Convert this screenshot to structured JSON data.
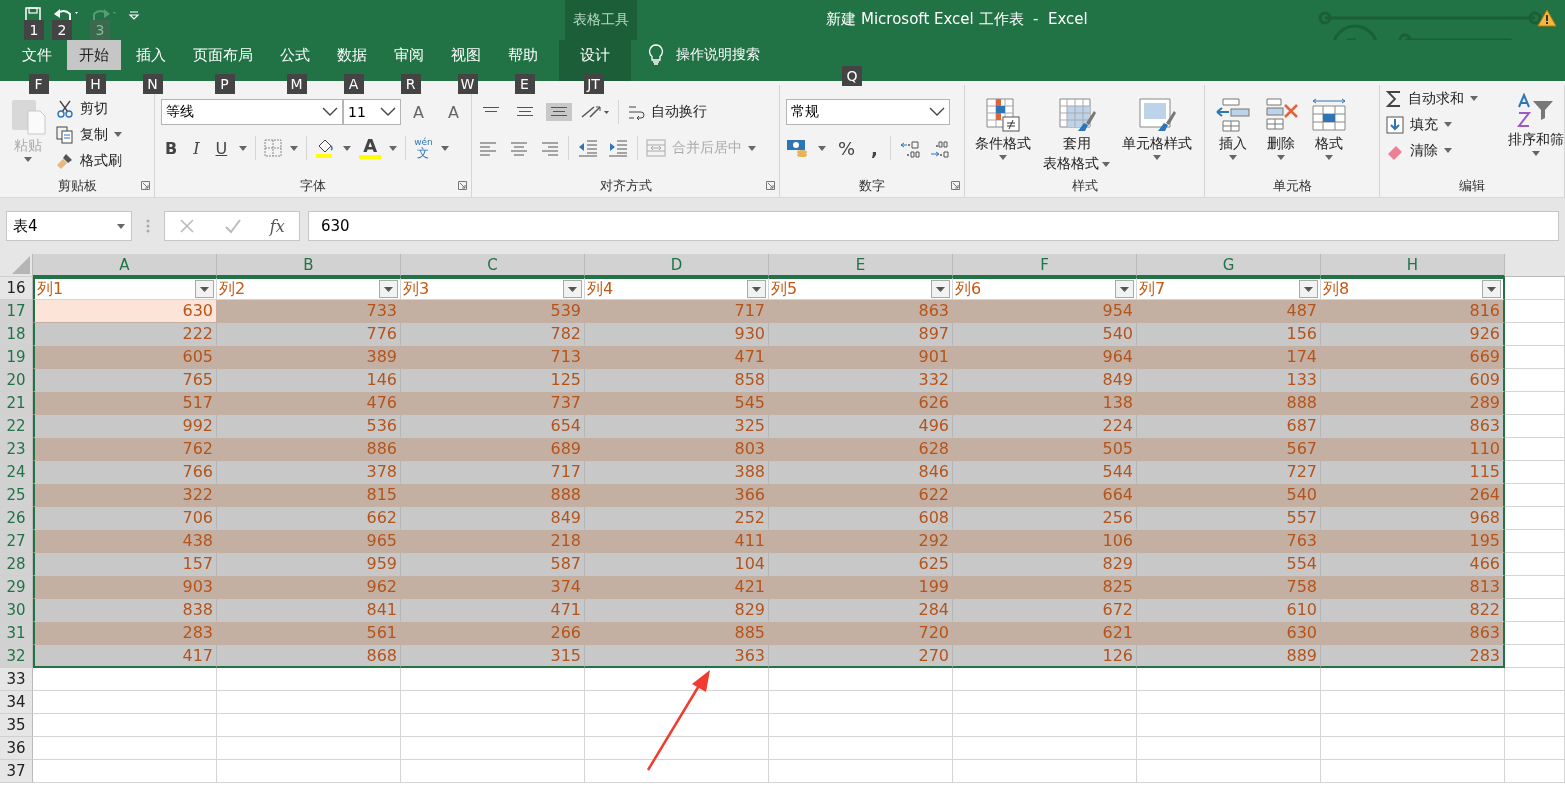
{
  "title_bar": {
    "quick_access": [
      {
        "kind": "save",
        "key": "1",
        "disabled": false
      },
      {
        "kind": "undo",
        "key": "2",
        "disabled": false
      },
      {
        "kind": "redo",
        "key": "3",
        "disabled": true
      },
      {
        "kind": "customize"
      }
    ],
    "context_label": "表格工具",
    "title": "新建 Microsoft Excel 工作表  -  Excel"
  },
  "tabs": [
    {
      "label": "文件",
      "key": "F",
      "selected": false,
      "contextual": false
    },
    {
      "label": "开始",
      "key": "H",
      "selected": true,
      "contextual": false
    },
    {
      "label": "插入",
      "key": "N",
      "selected": false,
      "contextual": false
    },
    {
      "label": "页面布局",
      "key": "P",
      "selected": false,
      "contextual": false
    },
    {
      "label": "公式",
      "key": "M",
      "selected": false,
      "contextual": false
    },
    {
      "label": "数据",
      "key": "A",
      "selected": false,
      "contextual": false
    },
    {
      "label": "审阅",
      "key": "R",
      "selected": false,
      "contextual": false
    },
    {
      "label": "视图",
      "key": "W",
      "selected": false,
      "contextual": false
    },
    {
      "label": "帮助",
      "key": "E",
      "selected": false,
      "contextual": false
    },
    {
      "label": "设计",
      "key": "JT",
      "selected": false,
      "contextual": true
    }
  ],
  "tell_me": {
    "label": "操作说明搜索",
    "key": "Q"
  },
  "ribbon": {
    "clipboard": {
      "title": "剪贴板",
      "paste": {
        "label": "粘贴",
        "disabled": true
      },
      "cut": "剪切",
      "copy": "复制",
      "format_painter": "格式刷",
      "launcher": true
    },
    "font": {
      "title": "字体",
      "font_name": "等线",
      "font_size": "11",
      "grow": "A",
      "shrink": "A",
      "bold": "B",
      "italic": "I",
      "underline": "U",
      "font_color": "A",
      "phonetic": {
        "top": "wén",
        "bottom": "文"
      },
      "launcher": true
    },
    "alignment": {
      "title": "对齐方式",
      "vertical": [
        {
          "selected": false
        },
        {
          "selected": false
        },
        {
          "selected": true
        }
      ],
      "wrap_text": {
        "label": "自动换行",
        "disabled": false
      },
      "merge": {
        "label": "合并后居中",
        "disabled": true
      },
      "launcher": true
    },
    "number": {
      "title": "数字",
      "format": "常规",
      "percent": "%",
      "comma": ",",
      "launcher": true
    },
    "styles": {
      "title": "样式",
      "conditional": "条件格式",
      "table_format": [
        "套用",
        "表格格式"
      ],
      "cell_styles": "单元格样式"
    },
    "cells": {
      "title": "单元格",
      "insert": "插入",
      "delete": "删除",
      "format": "格式"
    },
    "editing": {
      "title": "编辑",
      "autosum": "自动求和",
      "fill": "填充",
      "clear": "清除",
      "sort_filter": "排序和筛"
    }
  },
  "formula_bar": {
    "name_box": "表4",
    "function_label": "fx",
    "value": "630"
  },
  "sheet": {
    "columns": [
      {
        "label": "A",
        "selected": true
      },
      {
        "label": "B",
        "selected": true
      },
      {
        "label": "C",
        "selected": true
      },
      {
        "label": "D",
        "selected": true
      },
      {
        "label": "E",
        "selected": true
      },
      {
        "label": "F",
        "selected": true
      },
      {
        "label": "G",
        "selected": true
      },
      {
        "label": "H",
        "selected": true
      }
    ],
    "header_row": {
      "number": "16",
      "cells": [
        "列1",
        "列2",
        "列3",
        "列4",
        "列5",
        "列6",
        "列7",
        "列8"
      ]
    },
    "rows": [
      {
        "number": "17",
        "selected": true,
        "active": true,
        "cells": [
          "630",
          "733",
          "539",
          "717",
          "863",
          "954",
          "487",
          "816"
        ]
      },
      {
        "number": "18",
        "selected": true,
        "active": false,
        "cells": [
          "222",
          "776",
          "782",
          "930",
          "897",
          "540",
          "156",
          "926"
        ]
      },
      {
        "number": "19",
        "selected": true,
        "active": false,
        "cells": [
          "605",
          "389",
          "713",
          "471",
          "901",
          "964",
          "174",
          "669"
        ]
      },
      {
        "number": "20",
        "selected": true,
        "active": false,
        "cells": [
          "765",
          "146",
          "125",
          "858",
          "332",
          "849",
          "133",
          "609"
        ]
      },
      {
        "number": "21",
        "selected": true,
        "active": false,
        "cells": [
          "517",
          "476",
          "737",
          "545",
          "626",
          "138",
          "888",
          "289"
        ]
      },
      {
        "number": "22",
        "selected": true,
        "active": false,
        "cells": [
          "992",
          "536",
          "654",
          "325",
          "496",
          "224",
          "687",
          "863"
        ]
      },
      {
        "number": "23",
        "selected": true,
        "active": false,
        "cells": [
          "762",
          "886",
          "689",
          "803",
          "628",
          "505",
          "567",
          "110"
        ]
      },
      {
        "number": "24",
        "selected": true,
        "active": false,
        "cells": [
          "766",
          "378",
          "717",
          "388",
          "846",
          "544",
          "727",
          "115"
        ]
      },
      {
        "number": "25",
        "selected": true,
        "active": false,
        "cells": [
          "322",
          "815",
          "888",
          "366",
          "622",
          "664",
          "540",
          "264"
        ]
      },
      {
        "number": "26",
        "selected": true,
        "active": false,
        "cells": [
          "706",
          "662",
          "849",
          "252",
          "608",
          "256",
          "557",
          "968"
        ]
      },
      {
        "number": "27",
        "selected": true,
        "active": false,
        "cells": [
          "438",
          "965",
          "218",
          "411",
          "292",
          "106",
          "763",
          "195"
        ]
      },
      {
        "number": "28",
        "selected": true,
        "active": false,
        "cells": [
          "157",
          "959",
          "587",
          "104",
          "625",
          "829",
          "554",
          "466"
        ]
      },
      {
        "number": "29",
        "selected": true,
        "active": false,
        "cells": [
          "903",
          "962",
          "374",
          "421",
          "199",
          "825",
          "758",
          "813"
        ]
      },
      {
        "number": "30",
        "selected": true,
        "active": false,
        "cells": [
          "838",
          "841",
          "471",
          "829",
          "284",
          "672",
          "610",
          "822"
        ]
      },
      {
        "number": "31",
        "selected": true,
        "active": false,
        "cells": [
          "283",
          "561",
          "266",
          "885",
          "720",
          "621",
          "630",
          "863"
        ]
      },
      {
        "number": "32",
        "selected": true,
        "active": false,
        "cells": [
          "417",
          "868",
          "315",
          "363",
          "270",
          "126",
          "889",
          "283"
        ]
      },
      {
        "number": "33",
        "selected": false,
        "active": false,
        "cells": []
      },
      {
        "number": "34",
        "selected": false,
        "active": false,
        "cells": []
      },
      {
        "number": "35",
        "selected": false,
        "active": false,
        "cells": []
      },
      {
        "number": "36",
        "selected": false,
        "active": false,
        "cells": []
      },
      {
        "number": "37",
        "selected": false,
        "active": false,
        "cells": []
      }
    ]
  }
}
